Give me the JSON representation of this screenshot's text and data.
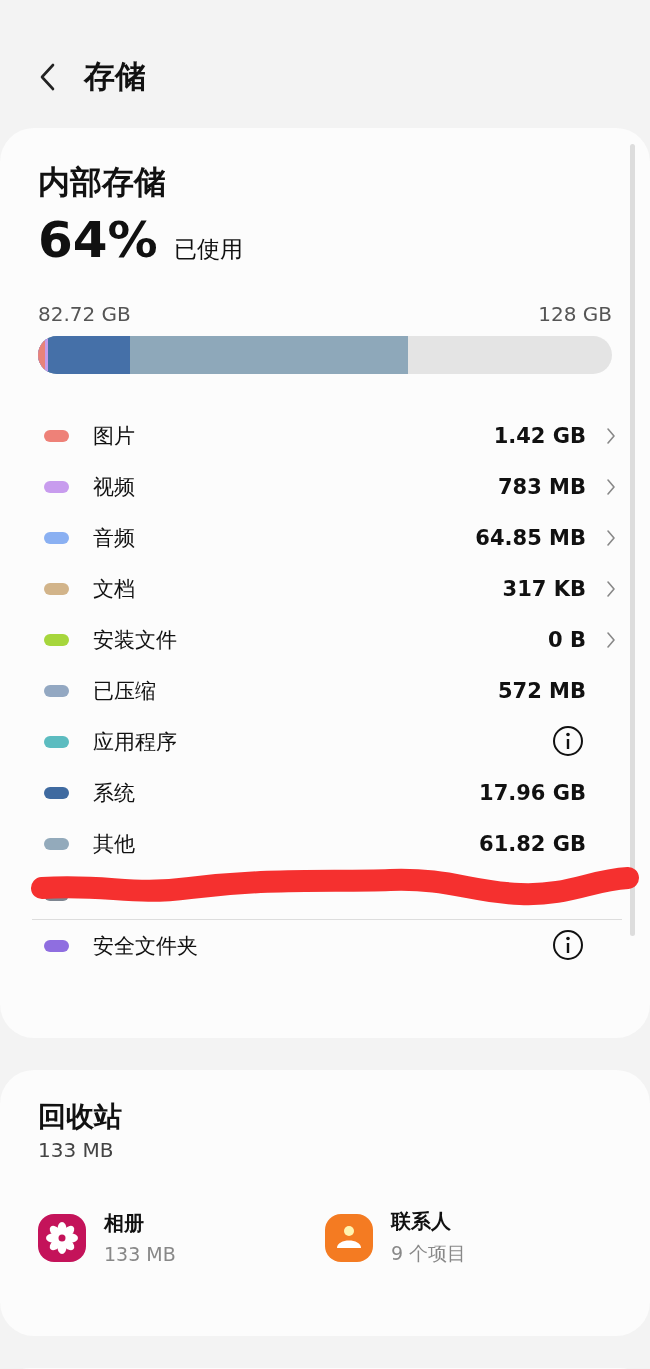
{
  "header": {
    "title": "存储"
  },
  "internal": {
    "title": "内部存储",
    "percent": "64%",
    "percent_label": "已使用",
    "used": "82.72 GB",
    "total": "128 GB",
    "segments": [
      {
        "level": 0.012
      },
      {
        "level": 0.018
      },
      {
        "level": 0.161
      },
      {
        "level": 0.645
      }
    ],
    "items": [
      {
        "name": "图片",
        "value": "1.42 GB",
        "color": "#ee8178",
        "kind": "link"
      },
      {
        "name": "视频",
        "value": "783 MB",
        "color": "#c89cee",
        "kind": "link"
      },
      {
        "name": "音频",
        "value": "64.85 MB",
        "color": "#8ab0f2",
        "kind": "link"
      },
      {
        "name": "文档",
        "value": "317 KB",
        "color": "#d2b48a",
        "kind": "link"
      },
      {
        "name": "安装文件",
        "value": "0 B",
        "color": "#a6d63c",
        "kind": "link"
      },
      {
        "name": "已压缩",
        "value": "572 MB",
        "color": "#93a8c2",
        "kind": "plain"
      },
      {
        "name": "应用程序",
        "color": "#5cbcc0",
        "kind": "info"
      },
      {
        "name": "系统",
        "value": "17.96 GB",
        "color": "#3f6aa0",
        "kind": "plain"
      },
      {
        "name": "其他",
        "value": "61.82 GB",
        "color": "#93aabb",
        "kind": "plain"
      },
      {
        "color": "#7d8590",
        "kind": "plain"
      },
      {
        "name": "安全文件夹",
        "color": "#8f6ee0",
        "kind": "info"
      }
    ]
  },
  "recycle": {
    "title": "回收站",
    "size": "133 MB",
    "apps": [
      {
        "name": "相册",
        "detail": "133 MB",
        "kind": "gallery"
      },
      {
        "name": "联系人",
        "detail": "9 个项目",
        "kind": "contacts"
      }
    ]
  }
}
